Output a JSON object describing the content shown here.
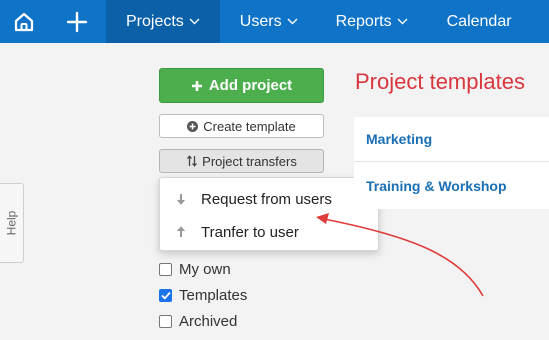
{
  "nav": {
    "projects": "Projects",
    "users": "Users",
    "reports": "Reports",
    "calendar": "Calendar"
  },
  "help": {
    "label": "Help"
  },
  "sidebar": {
    "add_project": "Add project",
    "create_template": "Create template",
    "project_transfers": "Project transfers"
  },
  "dropdown": {
    "items": [
      {
        "label": "Request from users",
        "icon": "arrow-down-icon"
      },
      {
        "label": "Tranfer to user",
        "icon": "arrow-up-icon"
      }
    ]
  },
  "filters": {
    "my_own": {
      "label": "My own",
      "checked": false
    },
    "templates": {
      "label": "Templates",
      "checked": true
    },
    "archived": {
      "label": "Archived",
      "checked": false
    }
  },
  "main": {
    "title": "Project templates",
    "templates": [
      "Marketing",
      "Training & Workshop"
    ]
  },
  "colors": {
    "nav_bg": "#0f74c8",
    "nav_active": "#0b60a8",
    "add_button": "#4cae4c",
    "title": "#d9363e",
    "link": "#1a6fb5",
    "annotation_arrow": "#e03b3b"
  }
}
